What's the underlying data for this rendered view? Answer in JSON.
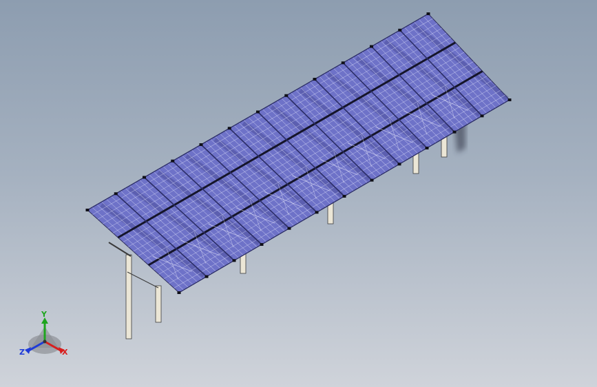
{
  "viewport": {
    "model": "solar-panel-array",
    "colors": {
      "panel": "#6e72c8",
      "panel_grid": "#e8eaff",
      "rail": "#15152a",
      "post": "#ebe6d6",
      "post_outline": "#3a3a3a"
    }
  },
  "triad": {
    "x_label": "X",
    "y_label": "Y",
    "z_label": "Z",
    "x_color": "#d81e1e",
    "y_color": "#1ea51e",
    "z_color": "#1e3ad8"
  }
}
